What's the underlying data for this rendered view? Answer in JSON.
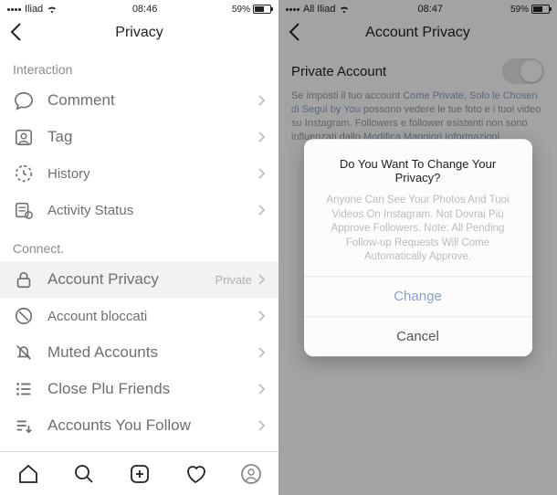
{
  "left": {
    "status": {
      "carrier": "Iliad",
      "time": "08:46",
      "battery": "59%"
    },
    "nav": {
      "title": "Privacy"
    },
    "sections": {
      "interaction": {
        "header": "Interaction",
        "items": [
          {
            "label": "Comment"
          },
          {
            "label": "Tag"
          },
          {
            "label": "History"
          },
          {
            "label": "Activity Status"
          }
        ]
      },
      "connect": {
        "header": "Connect.",
        "items": [
          {
            "label": "Account Privacy",
            "value": "Private"
          },
          {
            "label": "Account bloccati"
          },
          {
            "label": "Muted Accounts"
          },
          {
            "label": "Close Plu Friends"
          },
          {
            "label": "Accounts You Follow"
          }
        ]
      }
    }
  },
  "right": {
    "status": {
      "carrier": "All Iliad",
      "time": "08:47",
      "battery": "59%"
    },
    "nav": {
      "title": "Account Privacy"
    },
    "private": {
      "label": "Private Account",
      "desc_prefix": "Se imposti il tuo account ",
      "desc_link1": "Come Private, Solo le Chosen di Segui by You",
      "desc_mid": " possono vedere le tue foto e i tuoi video su Instagram. Followers e follower esistenti non sono influenzati dallo ",
      "desc_link2": "Modifica Maggiori Informazioni"
    },
    "dialog": {
      "title": "Do You Want To Change Your Privacy?",
      "message": "Anyone Can See Your Photos And Tuoi Videos On Instagram. Not Dovrai Più Approve Followers. Note: All Pending Follow-up Requests Will Come Automatically Approve.",
      "change": "Change",
      "cancel": "Cancel"
    }
  }
}
